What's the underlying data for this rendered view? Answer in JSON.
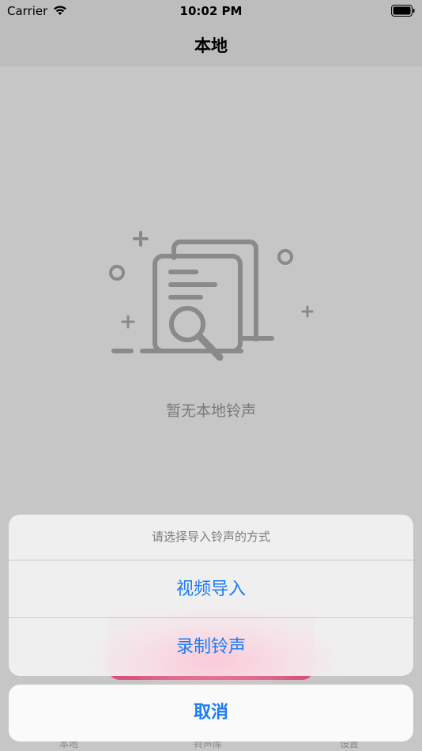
{
  "status": {
    "carrier": "Carrier",
    "time": "10:02 PM"
  },
  "nav": {
    "title": "本地"
  },
  "empty": {
    "message": "暂无本地铃声"
  },
  "tabs": [
    {
      "label": "本地"
    },
    {
      "label": "铃声库"
    },
    {
      "label": "设置"
    }
  ],
  "action_sheet": {
    "title": "请选择导入铃声的方式",
    "options": [
      {
        "label": "视频导入"
      },
      {
        "label": "录制铃声"
      }
    ],
    "cancel": "取消"
  },
  "colors": {
    "accent": "#1a7cf5",
    "background": "#c6c6c6",
    "pink": "#d9527a"
  }
}
